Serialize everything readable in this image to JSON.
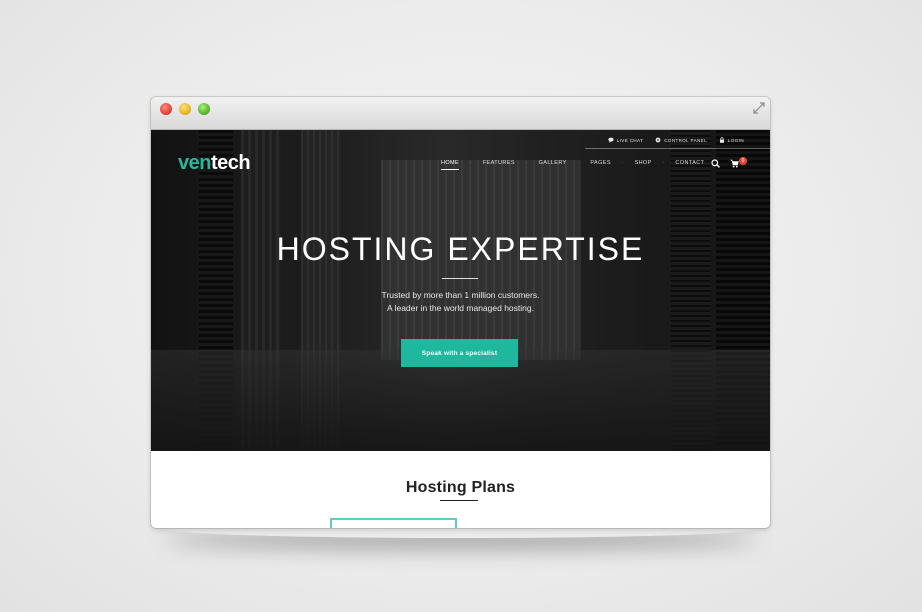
{
  "brand": {
    "logo_part1": "ven",
    "logo_part2": "tech",
    "accent": "#2bb5a0"
  },
  "utility_nav": [
    {
      "label": "LIVE CHAT",
      "icon": "chat-bubble-icon"
    },
    {
      "label": "CONTROL PANEL",
      "icon": "gear-icon"
    },
    {
      "label": "LOGIN",
      "icon": "lock-icon"
    }
  ],
  "nav": {
    "items": [
      {
        "label": "HOME",
        "active": true
      },
      {
        "label": "FEATURES",
        "active": false
      },
      {
        "label": "GALLERY",
        "active": false
      },
      {
        "label": "PAGES",
        "active": false
      },
      {
        "label": "SHOP",
        "active": false
      },
      {
        "label": "CONTACT",
        "active": false
      }
    ],
    "search_icon": "search-icon",
    "cart_icon": "cart-icon",
    "cart_count": "0"
  },
  "hero": {
    "title": "HOSTING EXPERTISE",
    "subtitle_line1": "Trusted by more than 1 million customers.",
    "subtitle_line2": "A leader in the world managed hosting.",
    "cta_label": "Speak with a specialist",
    "cta_color": "#1fb79e"
  },
  "section": {
    "title": "Hosting Plans"
  }
}
